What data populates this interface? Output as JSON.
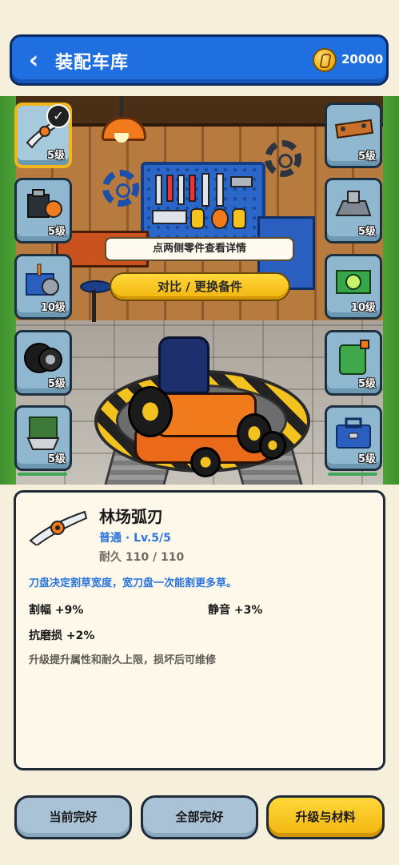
{
  "header": {
    "back_symbol": "‹",
    "title": "装配车库",
    "coins": "20000"
  },
  "scene": {
    "hint": "点两侧零件查看详情",
    "compare_button": "对比 / 更换备件"
  },
  "left_slots": [
    {
      "icon": "blade-icon",
      "level": "5级",
      "selected": true
    },
    {
      "icon": "engine-icon",
      "level": "5级",
      "selected": false
    },
    {
      "icon": "gearbox-icon",
      "level": "10级",
      "selected": false
    },
    {
      "icon": "tire-icon",
      "level": "5级",
      "selected": false
    },
    {
      "icon": "grass-bag-icon",
      "level": "5级",
      "selected": false
    }
  ],
  "right_slots": [
    {
      "icon": "frame-icon",
      "level": "5级"
    },
    {
      "icon": "chassis-icon",
      "level": "5级"
    },
    {
      "icon": "battery-icon",
      "level": "10级"
    },
    {
      "icon": "fuel-can-icon",
      "level": "5级"
    },
    {
      "icon": "toolbox-icon",
      "level": "5级"
    }
  ],
  "item": {
    "name": "林场弧刃",
    "grade": "普通 · Lv.5/5",
    "durability": "耐久 110 / 110",
    "description": "刀盘决定割草宽度，宽刀盘一次能割更多草。",
    "stats": [
      "割幅 +9%",
      "静音 +3%",
      "抗磨损 +2%"
    ],
    "note": "升级提升属性和耐久上限，损坏后可维修"
  },
  "buttons": {
    "current": "当前完好",
    "all": "全部完好",
    "upgrade": "升级与材料"
  },
  "colors": {
    "header_blue": "#1f6fe0",
    "accent_yellow": "#f2b50f",
    "info_blue": "#2a74dd"
  }
}
